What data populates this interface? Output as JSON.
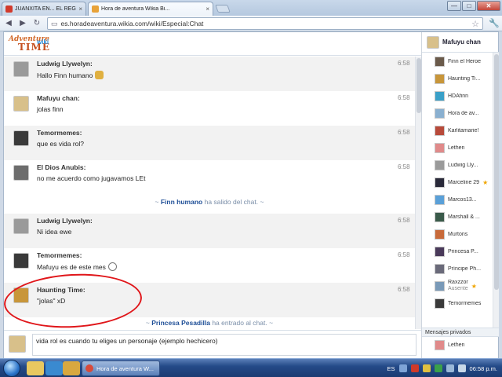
{
  "browser": {
    "tabs": [
      {
        "title": "JUANXITA EN... EL REGRESO",
        "favicon_color": "#d23a2c",
        "active": false
      },
      {
        "title": "Hora de aventura Wikia Bi...",
        "favicon_color": "#e8a33a",
        "active": true
      }
    ],
    "url": "es.horadeaventura.wikia.com/wiki/Especial:Chat",
    "window_buttons": {
      "minimize": "—",
      "maximize": "□",
      "close": "✕"
    }
  },
  "logo": {
    "line1": "Adventure",
    "line2": "TIME",
    "line3": "wiki"
  },
  "chat": {
    "messages": [
      {
        "user": "Ludwig Llywelyn:",
        "text": "Hallo Finn humano",
        "time": "6:58",
        "alt": true,
        "avatar_color": "#9a9a9a"
      },
      {
        "user": "Mafuyu chan:",
        "text": "jolas finn",
        "time": "6:58",
        "alt": false,
        "avatar_color": "#d8c08a"
      },
      {
        "user": "Temormemes:",
        "text": "que es vida rol?",
        "time": "6:58",
        "alt": true,
        "avatar_color": "#3a3a3a"
      },
      {
        "user": "El Dios Anubis:",
        "text": "no me acuerdo como jugavamos LEt",
        "time": "6:58",
        "alt": false,
        "avatar_color": "#6d6d6d"
      },
      {
        "user": "Ludwig Llywelyn:",
        "text": "Ni idea ewe",
        "time": "6:58",
        "alt": true,
        "avatar_color": "#9a9a9a"
      },
      {
        "user": "Temormemes:",
        "text": "Mafuyu es de este mes",
        "time": "6:58",
        "alt": false,
        "avatar_color": "#3a3a3a"
      },
      {
        "user": "Haunting Time:",
        "text": "\"jolas\" xD",
        "time": "6:58",
        "alt": true,
        "avatar_color": "#c8963a"
      }
    ],
    "inline_alerts": [
      {
        "user": "Finn humano",
        "text": "ha salido del chat.",
        "prefix": "~",
        "suffix": "~"
      },
      {
        "user": "Princesa Pesadilla",
        "text": "ha entrado al chat.",
        "prefix": "~",
        "suffix": "~"
      }
    ],
    "composer_value": "vida rol es cuando tu eliges un personaje (ejemplo hechicero)"
  },
  "sidebar": {
    "me": {
      "name": "Mafuyu chan",
      "avatar_color": "#d8c08a"
    },
    "users": [
      {
        "name": "Finn el Heroe",
        "avatar_color": "#6a5a4a",
        "staff": false
      },
      {
        "name": "Haunting Ti...",
        "avatar_color": "#c8963a",
        "staff": false
      },
      {
        "name": "HDAfinn",
        "avatar_color": "#3aa0c8",
        "staff": false
      },
      {
        "name": "Hora de av...",
        "avatar_color": "#8ab0d0",
        "staff": false
      },
      {
        "name": "Karlitamarie!",
        "avatar_color": "#b84a3a",
        "staff": false
      },
      {
        "name": "Lethen",
        "avatar_color": "#e08a8a",
        "staff": false
      },
      {
        "name": "Ludwig Lly...",
        "avatar_color": "#9a9a9a",
        "staff": false
      },
      {
        "name": "Marceline 29",
        "avatar_color": "#2a2a3a",
        "staff": true
      },
      {
        "name": "Marcos13...",
        "avatar_color": "#5aa0d8",
        "staff": false
      },
      {
        "name": "Marshall & ...",
        "avatar_color": "#3a5a4a",
        "staff": false
      },
      {
        "name": "Murtons",
        "avatar_color": "#c86a3a",
        "staff": false
      },
      {
        "name": "Princesa P...",
        "avatar_color": "#4a3a5a",
        "staff": false
      },
      {
        "name": "Príncipe Ph...",
        "avatar_color": "#6a6a7a",
        "staff": false
      },
      {
        "name": "Raxzzor",
        "status": "Ausente",
        "avatar_color": "#7a9ab8",
        "staff": true
      },
      {
        "name": "Temormemes",
        "avatar_color": "#3a3a3a",
        "staff": false
      }
    ],
    "private_header": "Mensajes privados",
    "private_users": [
      {
        "name": "Lethen",
        "avatar_color": "#e08a8a"
      }
    ]
  },
  "taskbar": {
    "window_title": "Hora de aventura W...",
    "language": "ES",
    "clock": "06:58 p.m."
  }
}
